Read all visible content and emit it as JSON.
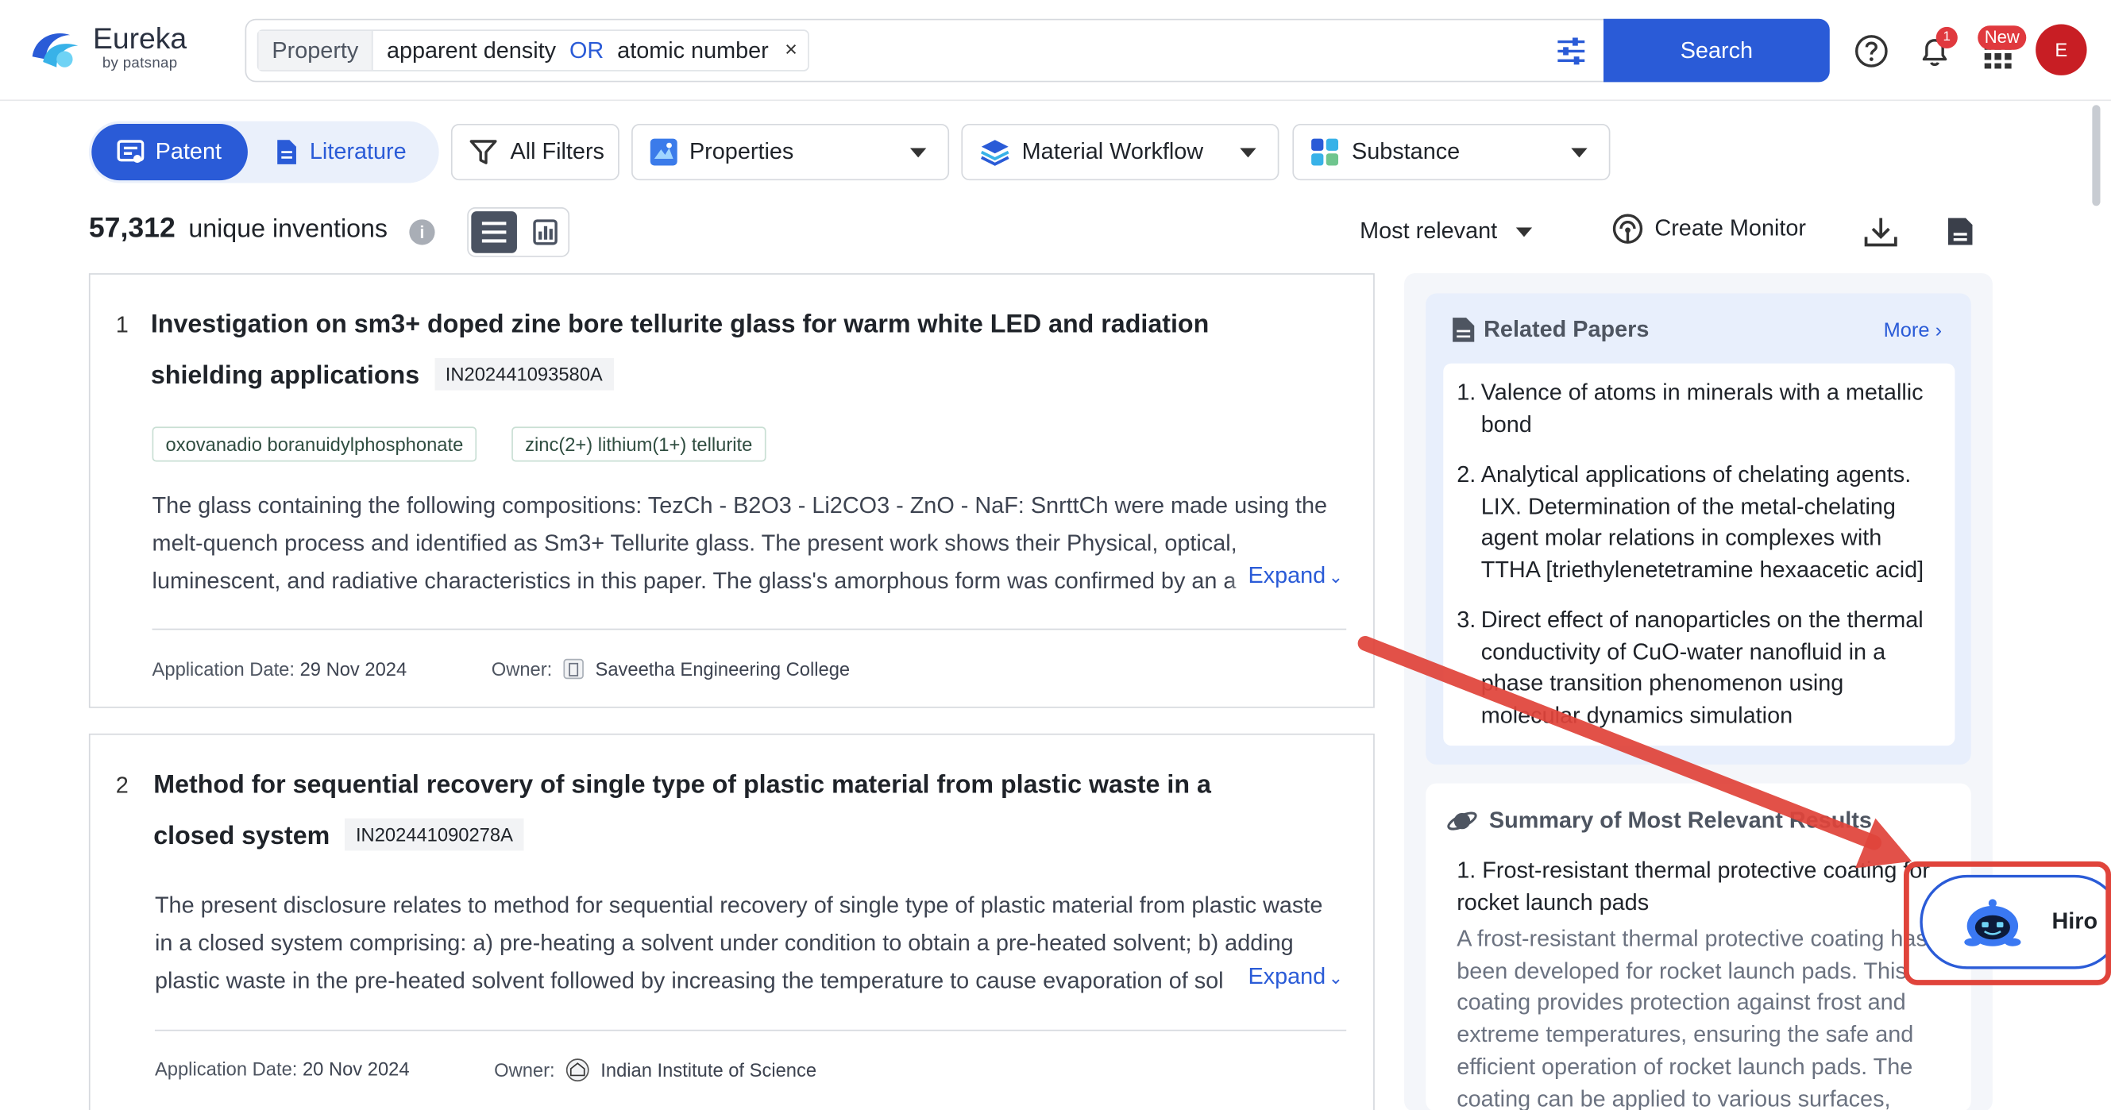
{
  "header": {
    "logo_name": "Eureka",
    "logo_sub": "by patsnap",
    "search": {
      "chip_property": "Property",
      "term1": "apparent density",
      "operator": "OR",
      "term2": "atomic number",
      "remove": "×"
    },
    "search_button": "Search",
    "notifications_count": "1",
    "apps_badge": "New",
    "avatar_initial": "E",
    "colors": {
      "primary": "#2a5bd7",
      "badge": "#e0393e",
      "avatar": "#c81e24"
    }
  },
  "toolbar": {
    "segment_patent": "Patent",
    "segment_literature": "Literature",
    "all_filters": "All Filters",
    "properties": "Properties",
    "material_workflow": "Material Workflow",
    "substance": "Substance"
  },
  "summary_bar": {
    "count": "57,312",
    "count_label": "unique inventions",
    "sort": "Most relevant",
    "create_monitor": "Create Monitor"
  },
  "results": [
    {
      "rank": "1",
      "title_line1": "Investigation on sm3+ doped zine bore tellurite glass for warm white LED and radiation",
      "title_line2": "shielding applications",
      "pub_no": "IN202441093580A",
      "tags": [
        "oxovanadio boranuidylphosphonate",
        "zinc(2+) lithium(1+) tellurite"
      ],
      "abstract_lines": [
        "The glass containing the following compositions: TezCh - B2O3 - Li2CO3 - ZnO - NaF: SnrttCh were made using the",
        "melt-quench process and identified as Sm3+ Tellurite glass. The present work shows their Physical, optical,",
        "luminescent, and radiative characteristics in this paper. The glass's amorphous form was confirmed by an a"
      ],
      "expand": "Expand",
      "date_label": "Application Date:",
      "date": "29 Nov 2024",
      "owner_label": "Owner:",
      "owner": "Saveetha Engineering College"
    },
    {
      "rank": "2",
      "title_line1": "Method for sequential recovery of single type of plastic material from plastic waste in a",
      "title_line2": "closed system",
      "pub_no": "IN202441090278A",
      "abstract_lines": [
        "The present disclosure relates to method for sequential recovery of single type of plastic material from plastic waste",
        "in a closed system comprising: a) pre-heating a solvent under condition to obtain a pre-heated solvent; b) adding",
        "plastic waste in the pre-heated solvent followed by increasing the temperature to cause evaporation of sol"
      ],
      "expand": "Expand",
      "date_label": "Application Date:",
      "date": "20 Nov 2024",
      "owner_label": "Owner:",
      "owner": "Indian Institute of Science"
    }
  ],
  "related_papers": {
    "heading": "Related Papers",
    "more": "More",
    "items": [
      {
        "n": "1.",
        "text": "Valence of atoms in minerals with a metallic bond"
      },
      {
        "n": "2.",
        "text": "Analytical applications of chelating agents. LIX. Determination of the metal-chelating agent molar relations in complexes with TTHA [triethylenetetramine hexaacetic acid]"
      },
      {
        "n": "3.",
        "text": "Direct effect of nanoparticles on the thermal conductivity of CuO-water nanofluid in a phase transition phenomenon using molecular dynamics simulation"
      }
    ]
  },
  "summary_panel": {
    "heading": "Summary of Most Relevant Results",
    "item_title": "1. Frost-resistant thermal protective coating for rocket launch pads",
    "item_text": "A frost-resistant thermal protective coating has been developed for rocket launch pads. This coating provides protection against frost and extreme temperatures, ensuring the safe and efficient operation of rocket launch pads. The coating can be applied to various surfaces,"
  },
  "assistant": {
    "label": "Hiro",
    "highlight_color": "#e0443b"
  }
}
